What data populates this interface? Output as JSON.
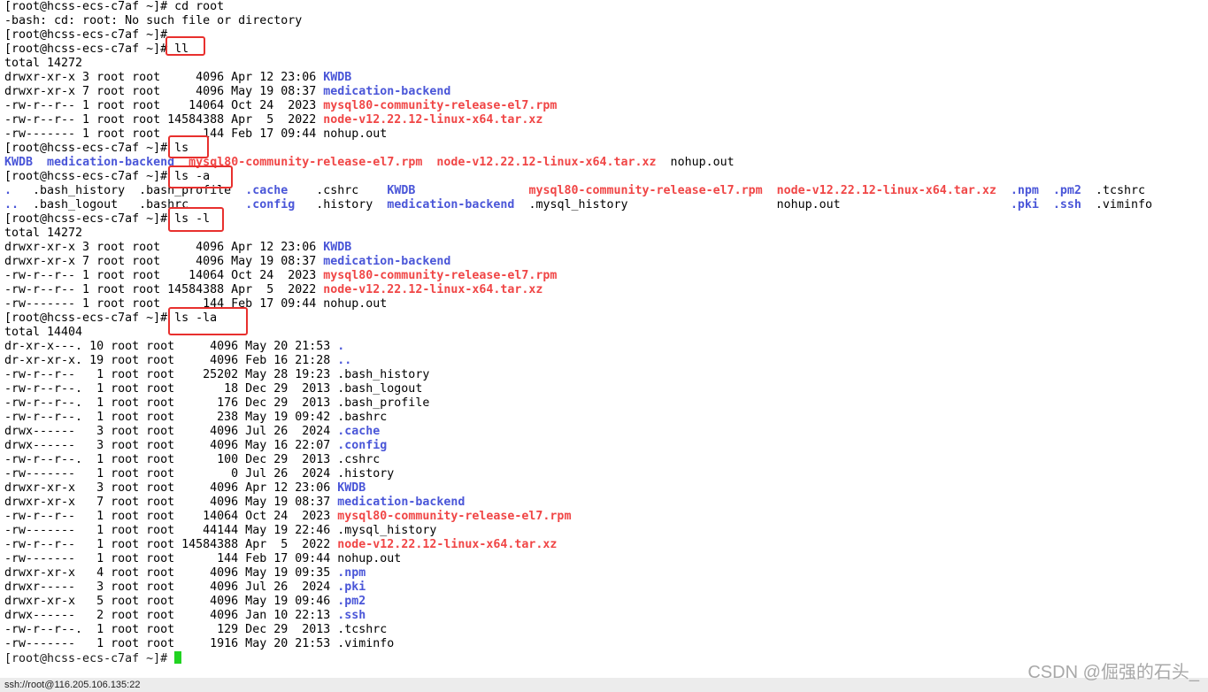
{
  "terminal": {
    "prompt": "[root@hcss-ecs-c7af ~]# ",
    "lines": [
      [
        {
          "t": "[root@hcss-ecs-c7af ~]# cd root"
        }
      ],
      [
        {
          "t": "-bash: cd: root: No such file or directory"
        }
      ],
      [
        {
          "t": "[root@hcss-ecs-c7af ~]#"
        }
      ],
      [
        {
          "t": "[root@hcss-ecs-c7af ~]# ll"
        }
      ],
      [
        {
          "t": "total 14272"
        }
      ],
      [
        {
          "t": "drwxr-xr-x 3 root root     4096 Apr 12 23:06 "
        },
        {
          "t": "KWDB",
          "c": "dir"
        }
      ],
      [
        {
          "t": "drwxr-xr-x 7 root root     4096 May 19 08:37 "
        },
        {
          "t": "medication-backend",
          "c": "dir"
        }
      ],
      [
        {
          "t": "-rw-r--r-- 1 root root    14064 Oct 24  2023 "
        },
        {
          "t": "mysql80-community-release-el7.rpm",
          "c": "arc"
        }
      ],
      [
        {
          "t": "-rw-r--r-- 1 root root 14584388 Apr  5  2022 "
        },
        {
          "t": "node-v12.22.12-linux-x64.tar.xz",
          "c": "arc"
        }
      ],
      [
        {
          "t": "-rw------- 1 root root      144 Feb 17 09:44 nohup.out"
        }
      ],
      [
        {
          "t": "[root@hcss-ecs-c7af ~]# ls"
        }
      ],
      [
        {
          "t": "KWDB",
          "c": "dir"
        },
        {
          "t": "  "
        },
        {
          "t": "medication-backend",
          "c": "dir"
        },
        {
          "t": "  "
        },
        {
          "t": "mysql80-community-release-el7.rpm",
          "c": "arc"
        },
        {
          "t": "  "
        },
        {
          "t": "node-v12.22.12-linux-x64.tar.xz",
          "c": "arc"
        },
        {
          "t": "  nohup.out"
        }
      ],
      [
        {
          "t": "[root@hcss-ecs-c7af ~]# ls -a"
        }
      ],
      [
        {
          "t": ".",
          "c": "dir"
        },
        {
          "t": "   .bash_history  .bash_profile  "
        },
        {
          "t": ".cache",
          "c": "dir"
        },
        {
          "t": "    .cshrc    "
        },
        {
          "t": "KWDB",
          "c": "dir"
        },
        {
          "t": "                "
        },
        {
          "t": "mysql80-community-release-el7.rpm",
          "c": "arc"
        },
        {
          "t": "  "
        },
        {
          "t": "node-v12.22.12-linux-x64.tar.xz",
          "c": "arc"
        },
        {
          "t": "  "
        },
        {
          "t": ".npm",
          "c": "dir"
        },
        {
          "t": "  "
        },
        {
          "t": ".pm2",
          "c": "dir"
        },
        {
          "t": "  .tcshrc"
        }
      ],
      [
        {
          "t": "..",
          "c": "dir"
        },
        {
          "t": "  .bash_logout   .bashrc        "
        },
        {
          "t": ".config",
          "c": "dir"
        },
        {
          "t": "   .history  "
        },
        {
          "t": "medication-backend",
          "c": "dir"
        },
        {
          "t": "  .mysql_history                     nohup.out                        "
        },
        {
          "t": ".pki",
          "c": "dir"
        },
        {
          "t": "  "
        },
        {
          "t": ".ssh",
          "c": "dir"
        },
        {
          "t": "  .viminfo"
        }
      ],
      [
        {
          "t": "[root@hcss-ecs-c7af ~]# ls -l"
        }
      ],
      [
        {
          "t": "total 14272"
        }
      ],
      [
        {
          "t": "drwxr-xr-x 3 root root     4096 Apr 12 23:06 "
        },
        {
          "t": "KWDB",
          "c": "dir"
        }
      ],
      [
        {
          "t": "drwxr-xr-x 7 root root     4096 May 19 08:37 "
        },
        {
          "t": "medication-backend",
          "c": "dir"
        }
      ],
      [
        {
          "t": "-rw-r--r-- 1 root root    14064 Oct 24  2023 "
        },
        {
          "t": "mysql80-community-release-el7.rpm",
          "c": "arc"
        }
      ],
      [
        {
          "t": "-rw-r--r-- 1 root root 14584388 Apr  5  2022 "
        },
        {
          "t": "node-v12.22.12-linux-x64.tar.xz",
          "c": "arc"
        }
      ],
      [
        {
          "t": "-rw------- 1 root root      144 Feb 17 09:44 nohup.out"
        }
      ],
      [
        {
          "t": "[root@hcss-ecs-c7af ~]# ls -la"
        }
      ],
      [
        {
          "t": "total 14404"
        }
      ],
      [
        {
          "t": "dr-xr-x---. 10 root root     4096 May 20 21:53 "
        },
        {
          "t": ".",
          "c": "dir"
        }
      ],
      [
        {
          "t": "dr-xr-xr-x. 19 root root     4096 Feb 16 21:28 "
        },
        {
          "t": "..",
          "c": "dir"
        }
      ],
      [
        {
          "t": "-rw-r--r--   1 root root    25202 May 28 19:23 .bash_history"
        }
      ],
      [
        {
          "t": "-rw-r--r--.  1 root root       18 Dec 29  2013 .bash_logout"
        }
      ],
      [
        {
          "t": "-rw-r--r--.  1 root root      176 Dec 29  2013 .bash_profile"
        }
      ],
      [
        {
          "t": "-rw-r--r--.  1 root root      238 May 19 09:42 .bashrc"
        }
      ],
      [
        {
          "t": "drwx------   3 root root     4096 Jul 26  2024 "
        },
        {
          "t": ".cache",
          "c": "dir"
        }
      ],
      [
        {
          "t": "drwx------   3 root root     4096 May 16 22:07 "
        },
        {
          "t": ".config",
          "c": "dir"
        }
      ],
      [
        {
          "t": "-rw-r--r--.  1 root root      100 Dec 29  2013 .cshrc"
        }
      ],
      [
        {
          "t": "-rw-------   1 root root        0 Jul 26  2024 .history"
        }
      ],
      [
        {
          "t": "drwxr-xr-x   3 root root     4096 Apr 12 23:06 "
        },
        {
          "t": "KWDB",
          "c": "dir"
        }
      ],
      [
        {
          "t": "drwxr-xr-x   7 root root     4096 May 19 08:37 "
        },
        {
          "t": "medication-backend",
          "c": "dir"
        }
      ],
      [
        {
          "t": "-rw-r--r--   1 root root    14064 Oct 24  2023 "
        },
        {
          "t": "mysql80-community-release-el7.rpm",
          "c": "arc"
        }
      ],
      [
        {
          "t": "-rw-------   1 root root    44144 May 19 22:46 .mysql_history"
        }
      ],
      [
        {
          "t": "-rw-r--r--   1 root root 14584388 Apr  5  2022 "
        },
        {
          "t": "node-v12.22.12-linux-x64.tar.xz",
          "c": "arc"
        }
      ],
      [
        {
          "t": "-rw-------   1 root root      144 Feb 17 09:44 nohup.out"
        }
      ],
      [
        {
          "t": "drwxr-xr-x   4 root root     4096 May 19 09:35 "
        },
        {
          "t": ".npm",
          "c": "dir"
        }
      ],
      [
        {
          "t": "drwxr-----   3 root root     4096 Jul 26  2024 "
        },
        {
          "t": ".pki",
          "c": "dir"
        }
      ],
      [
        {
          "t": "drwxr-xr-x   5 root root     4096 May 19 09:46 "
        },
        {
          "t": ".pm2",
          "c": "dir"
        }
      ],
      [
        {
          "t": "drwx------   2 root root     4096 Jan 10 22:13 "
        },
        {
          "t": ".ssh",
          "c": "dir"
        }
      ],
      [
        {
          "t": "-rw-r--r--.  1 root root      129 Dec 29  2013 .tcshrc"
        }
      ],
      [
        {
          "t": "-rw-------   1 root root     1916 May 20 21:53 .viminfo"
        }
      ]
    ]
  },
  "status_bar": {
    "text": "ssh://root@116.205.106.135:22"
  },
  "watermark": {
    "text": "CSDN @倔强的石头_"
  },
  "colors": {
    "directory": "#4a56d8",
    "archive": "#f04646",
    "highlight_box": "#e8302e",
    "cursor": "#21d321"
  }
}
